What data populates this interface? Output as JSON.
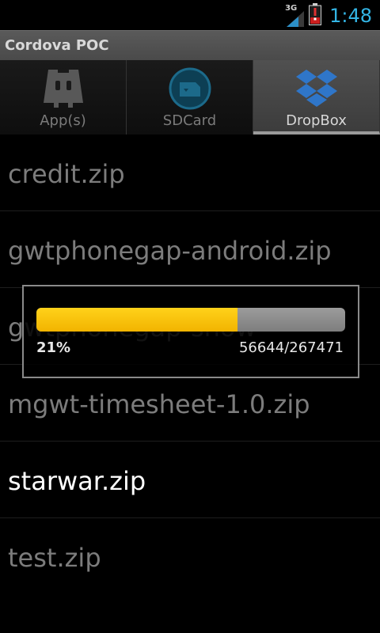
{
  "status_bar": {
    "network_label": "3G",
    "clock": "1:48",
    "clock_color": "#33b5e5",
    "icons": [
      "3g-signal-icon",
      "battery-alert-icon"
    ]
  },
  "app": {
    "title": "Cordova POC"
  },
  "tabs": [
    {
      "label": "App(s)",
      "icon": "cordova-robot-icon",
      "selected": false
    },
    {
      "label": "SDCard",
      "icon": "sdcard-icon",
      "selected": false
    },
    {
      "label": "DropBox",
      "icon": "dropbox-icon",
      "selected": true
    }
  ],
  "files": [
    {
      "name": "credit.zip"
    },
    {
      "name": "gwtphonegap-android.zip"
    },
    {
      "name": "gwtphonegap-show"
    },
    {
      "name": "mgwt-timesheet-1.0.zip"
    },
    {
      "name": "starwar.zip"
    },
    {
      "name": "test.zip"
    }
  ],
  "progress": {
    "percent_label": "21%",
    "count_label": "56644/267471",
    "fraction": 0.21,
    "bar_color": "#ffc800"
  }
}
